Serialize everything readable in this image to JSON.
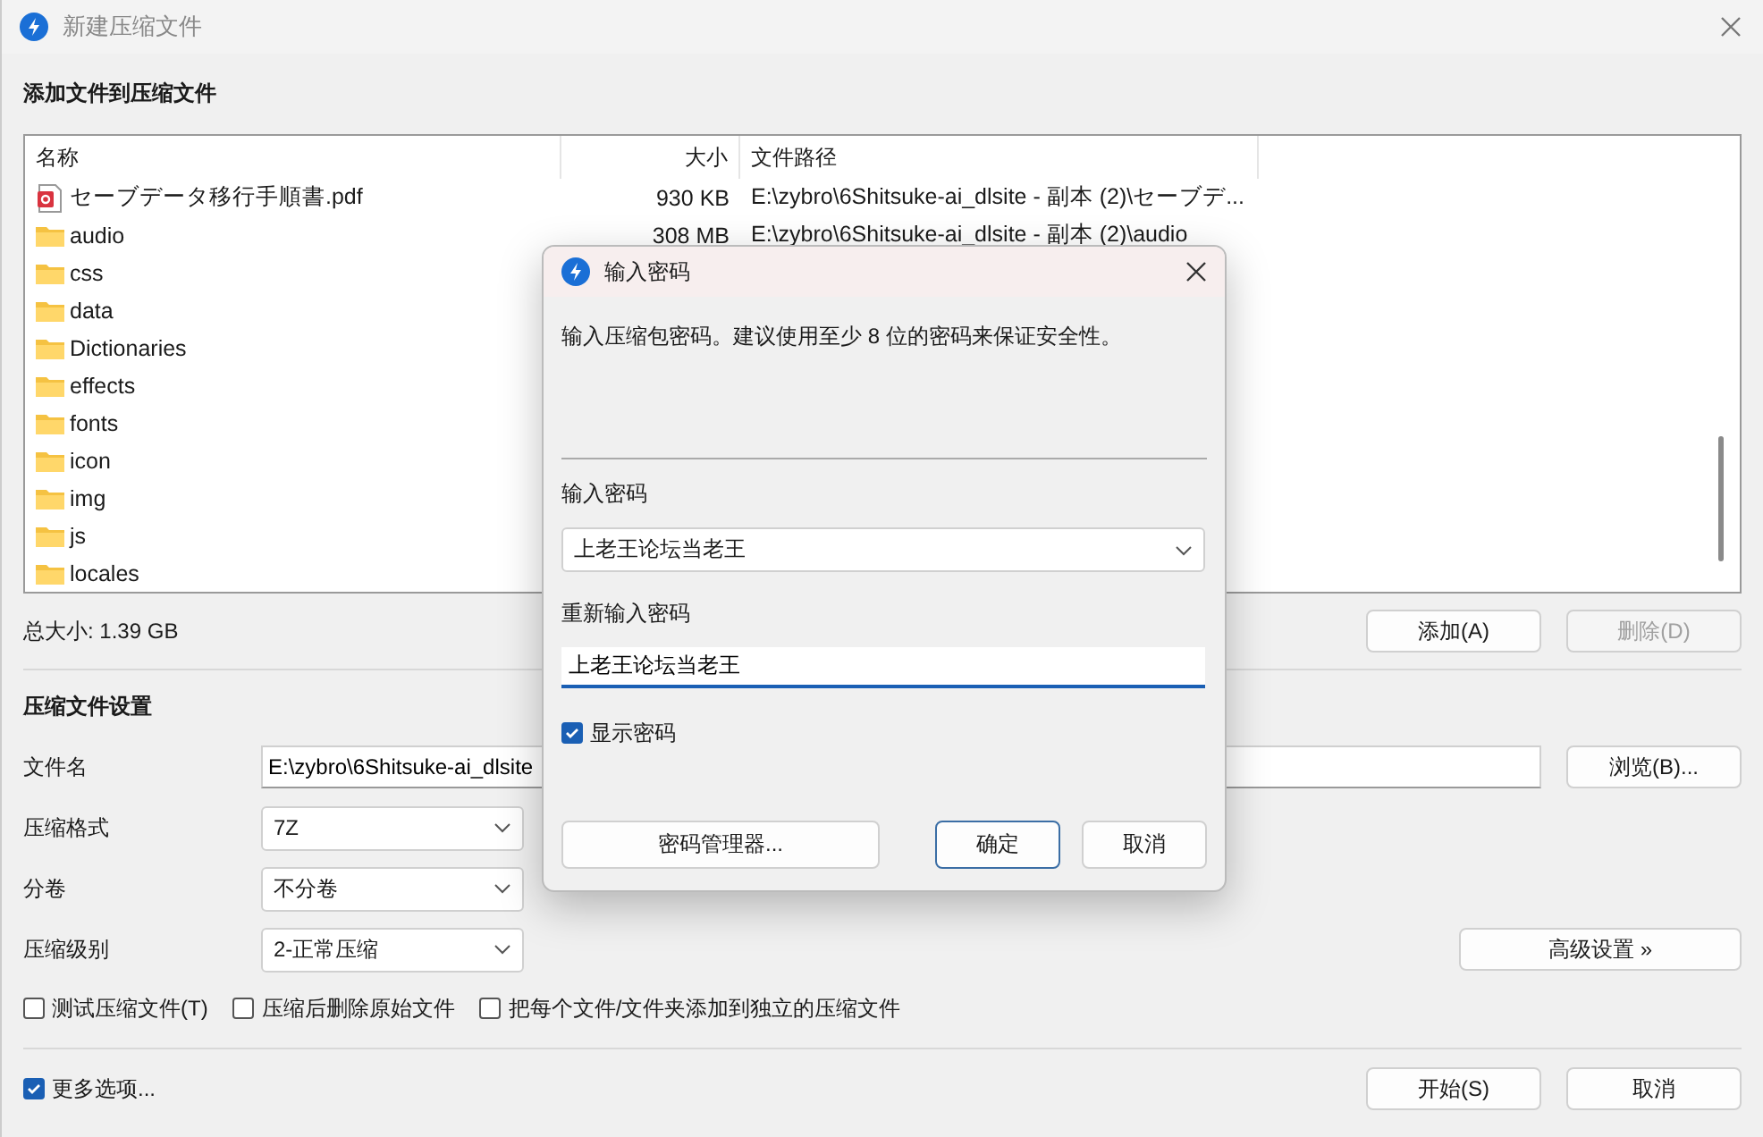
{
  "window": {
    "title": "新建压缩文件"
  },
  "files_section": {
    "heading": "添加文件到压缩文件",
    "columns": [
      "名称",
      "大小",
      "文件路径"
    ],
    "rows": [
      {
        "kind": "pdf",
        "name": "セーブデータ移行手順書.pdf",
        "size": "930 KB",
        "path": "E:\\zybro\\6Shitsuke-ai_dlsite - 副本 (2)\\セーブデ..."
      },
      {
        "kind": "folder",
        "name": "audio",
        "size": "308 MB",
        "path": "E:\\zybro\\6Shitsuke-ai_dlsite - 副本 (2)\\audio"
      },
      {
        "kind": "folder",
        "name": "css"
      },
      {
        "kind": "folder",
        "name": "data"
      },
      {
        "kind": "folder",
        "name": "Dictionaries"
      },
      {
        "kind": "folder",
        "name": "effects"
      },
      {
        "kind": "folder",
        "name": "fonts"
      },
      {
        "kind": "folder",
        "name": "icon"
      },
      {
        "kind": "folder",
        "name": "img"
      },
      {
        "kind": "folder",
        "name": "js"
      },
      {
        "kind": "folder",
        "name": "locales"
      }
    ],
    "total": "总大小: 1.39 GB",
    "buttons": [
      {
        "label": "添加(A)",
        "disabled": false
      },
      {
        "label": "删除(D)",
        "disabled": true
      }
    ]
  },
  "settings": {
    "heading": "压缩文件设置",
    "filename": {
      "label": "文件名",
      "value": "E:\\zybro\\6Shitsuke-ai_dlsite"
    },
    "browse_button": "浏览(B)...",
    "selects": [
      {
        "label": "压缩格式",
        "value": "7Z"
      },
      {
        "label": "分卷",
        "value": "不分卷"
      },
      {
        "label": "压缩级别",
        "value": "2-正常压缩"
      }
    ],
    "advanced_button": "高级设置 »",
    "options": [
      {
        "label": "测试压缩文件(T)",
        "checked": false
      },
      {
        "label": "压缩后删除原始文件",
        "checked": false
      },
      {
        "label": "把每个文件/文件夹添加到独立的压缩文件",
        "checked": false
      }
    ]
  },
  "footer": {
    "more_options": {
      "label": "更多选项...",
      "checked": true
    },
    "buttons": [
      "开始(S)",
      "取消"
    ]
  },
  "password_dialog": {
    "title": "输入密码",
    "description": "输入压缩包密码。建议使用至少 8 位的密码来保证安全性。",
    "password_label": "输入密码",
    "password_value": "上老王论坛当老王",
    "confirm_label": "重新输入密码",
    "confirm_value": "上老王论坛当老王",
    "show_password": {
      "label": "显示密码",
      "checked": true
    },
    "manager_button": "密码管理器...",
    "buttons": [
      {
        "label": "确定",
        "default": true
      },
      {
        "label": "取消",
        "default": false
      }
    ]
  }
}
